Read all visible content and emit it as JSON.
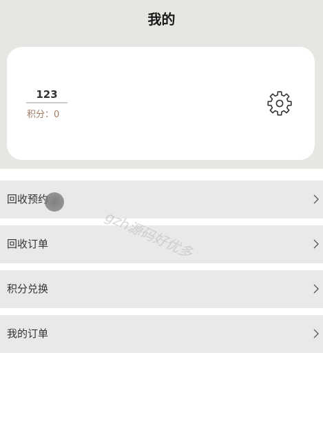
{
  "header": {
    "title": "我的"
  },
  "profile": {
    "username": "123",
    "points_label": "积分：",
    "points_value": "0",
    "settings_icon": "gear-icon"
  },
  "menu": {
    "items": [
      {
        "label": "回收预约",
        "icon": "chevron-right-icon"
      },
      {
        "label": "回收订单",
        "icon": "chevron-right-icon"
      },
      {
        "label": "积分兑换",
        "icon": "chevron-right-icon"
      },
      {
        "label": "我的订单",
        "icon": "chevron-right-icon"
      }
    ]
  },
  "watermark": {
    "text": "gzh源码好优多"
  },
  "colors": {
    "header_background": "#e6e6e3",
    "card_background": "#ffffff",
    "menu_item_background": "#e9e9e9",
    "points_text": "#a07a62"
  }
}
